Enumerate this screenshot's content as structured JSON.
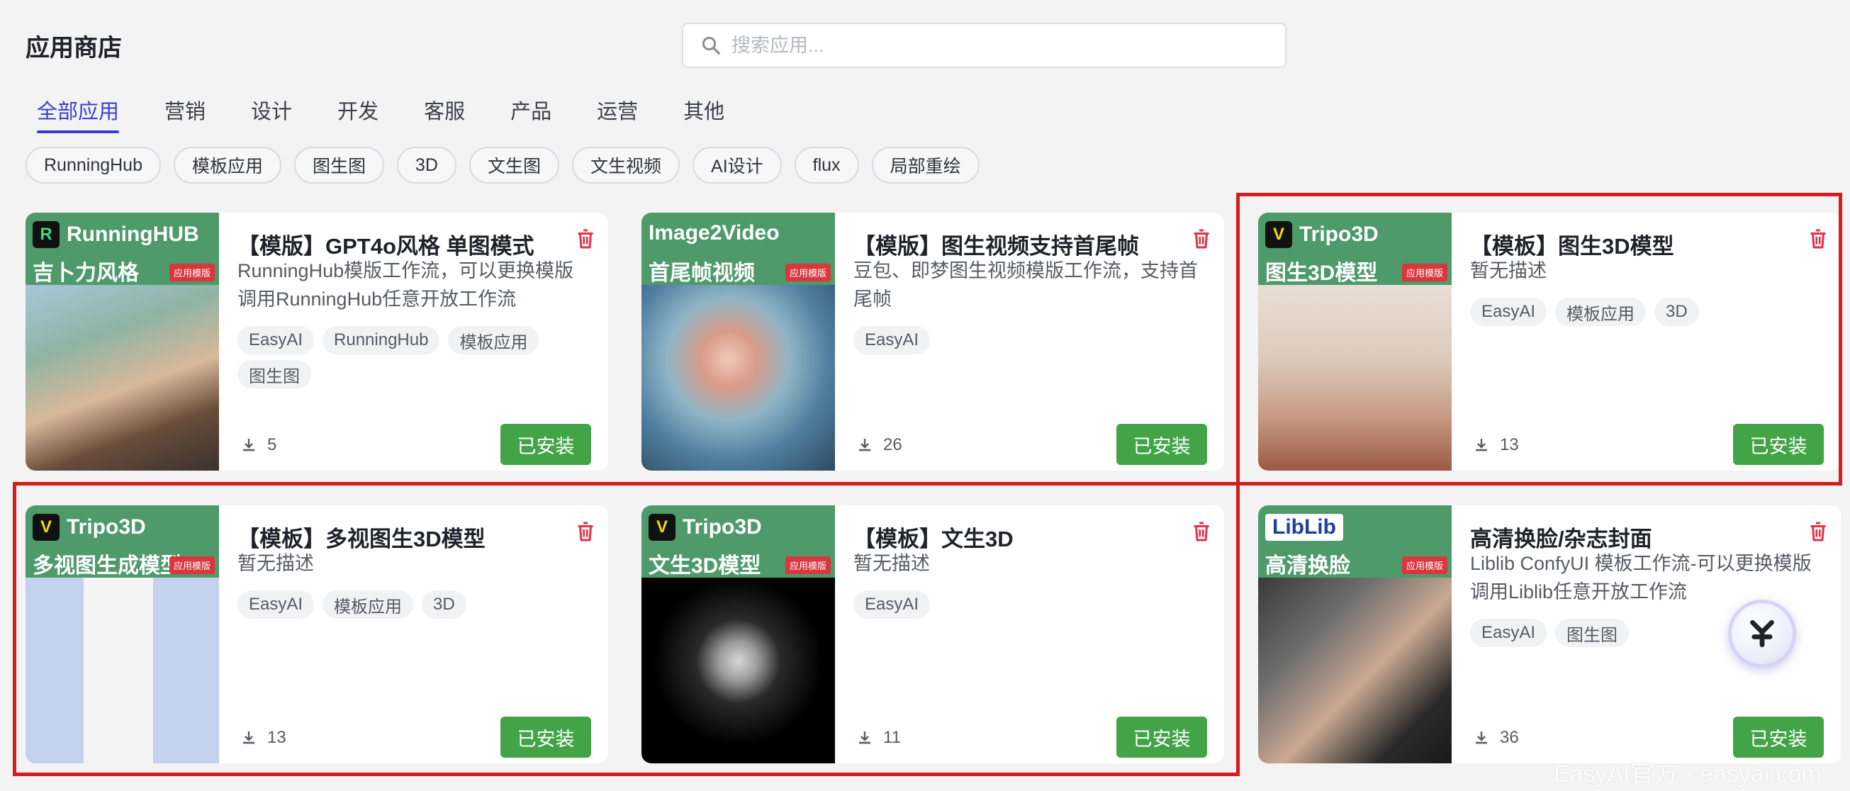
{
  "page": {
    "title": "应用商店"
  },
  "search": {
    "placeholder": "搜索应用..."
  },
  "tabs": [
    {
      "label": "全部应用",
      "active": true
    },
    {
      "label": "营销"
    },
    {
      "label": "设计"
    },
    {
      "label": "开发"
    },
    {
      "label": "客服"
    },
    {
      "label": "产品"
    },
    {
      "label": "运营"
    },
    {
      "label": "其他"
    }
  ],
  "chips": [
    "RunningHub",
    "模板应用",
    "图生图",
    "3D",
    "文生图",
    "文生视频",
    "AI设计",
    "flux",
    "局部重绘"
  ],
  "cards": [
    {
      "title": "【模版】GPT4o风格 单图模式",
      "description": "RunningHub模版工作流，可以更换模版调用RunningHub任意开放工作流",
      "tags": [
        "EasyAI",
        "RunningHub",
        "模板应用",
        "图生图"
      ],
      "downloads": "5",
      "button": "已安装",
      "thumb": {
        "brand": "RunningHUB",
        "subtitle": "吉卜力风格",
        "badge": "应用模版",
        "brand_icon": "runninghub-logo-icon"
      }
    },
    {
      "title": "【模版】图生视频支持首尾帧",
      "description": "豆包、即梦图生视频模版工作流，支持首尾帧",
      "tags": [
        "EasyAI"
      ],
      "downloads": "26",
      "button": "已安装",
      "thumb": {
        "brand": "Image2Video",
        "subtitle": "首尾帧视频",
        "badge": "应用模版"
      }
    },
    {
      "title": "【模板】图生3D模型",
      "description": "暂无描述",
      "tags": [
        "EasyAI",
        "模板应用",
        "3D"
      ],
      "downloads": "13",
      "button": "已安装",
      "thumb": {
        "brand": "Tripo3D",
        "subtitle": "图生3D模型",
        "badge": "应用模版",
        "brand_icon": "tripo-logo-icon"
      }
    },
    {
      "title": "【模板】多视图生3D模型",
      "description": "暂无描述",
      "tags": [
        "EasyAI",
        "模板应用",
        "3D"
      ],
      "downloads": "13",
      "button": "已安装",
      "thumb": {
        "brand": "Tripo3D",
        "subtitle": "多视图生成模型",
        "badge": "应用模版",
        "brand_icon": "tripo-logo-icon"
      }
    },
    {
      "title": "【模板】文生3D",
      "description": "暂无描述",
      "tags": [
        "EasyAI"
      ],
      "downloads": "11",
      "button": "已安装",
      "thumb": {
        "brand": "Tripo3D",
        "subtitle": "文生3D模型",
        "badge": "应用模版",
        "brand_icon": "tripo-logo-icon"
      }
    },
    {
      "title": "高清换脸/杂志封面",
      "description": "Liblib ConfyUI 模板工作流-可以更换模版调用Liblib任意开放工作流",
      "tags": [
        "EasyAI",
        "图生图"
      ],
      "downloads": "36",
      "button": "已安装",
      "thumb": {
        "brand": "LibLib",
        "subtitle": "高清换脸",
        "badge": "应用模版"
      }
    }
  ],
  "colors": {
    "accent": "#3b3bd4",
    "installed": "#43a447",
    "delete": "#e0334a",
    "highlight": "#d61c1c",
    "thumb_header": "#4e9a6b"
  },
  "watermark": "EasyAI官方 · easyai.com"
}
